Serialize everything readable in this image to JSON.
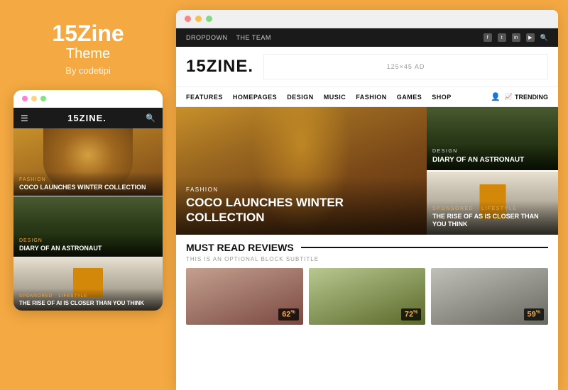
{
  "left": {
    "title": "15Zine",
    "subtitle": "Theme",
    "byline": "By codetipi",
    "dots": [
      "dot1",
      "dot2",
      "dot3"
    ],
    "phone": {
      "nav_logo": "15ZINE.",
      "cards": [
        {
          "category": "FASHION",
          "title": "COCO LAUNCHES WINTER COLLECTION"
        },
        {
          "category": "DESIGN",
          "title": "DIARY OF AN ASTRONAUT"
        },
        {
          "category": "SPONSORED · LIFESTYLE",
          "title": "THE RISE OF AI IS CLOSER THAN YOU THINK"
        }
      ]
    }
  },
  "browser": {
    "top_nav": {
      "left": [
        "DROPDOWN",
        "THE TEAM"
      ],
      "social": [
        "f",
        "t",
        "in",
        "yt"
      ],
      "search": "🔍"
    },
    "header": {
      "logo": "15ZINE.",
      "ad_text": "125×45 AD"
    },
    "nav": {
      "items": [
        "FEATURES",
        "HOMEPAGES",
        "DESIGN",
        "MUSIC",
        "FASHION",
        "GAMES",
        "SHOP"
      ],
      "trending": "TRENDING"
    },
    "hero": {
      "main": {
        "category": "FASHION",
        "title": "COCO LAUNCHES WINTER COLLECTION"
      },
      "cards": [
        {
          "category": "DESIGN",
          "title": "DIARY OF AN ASTRONAUT"
        },
        {
          "category": "SPONSORED · LIFESTYLE",
          "title": "THE RISE OF AS IS CLOSER THAN YOU THINK"
        }
      ]
    },
    "must_read": {
      "title": "MUST READ REVIEWS",
      "line": true,
      "subtitle": "THIS IS AN OPTIONAL BLOCK SUBTITLE",
      "cards": [
        {
          "score": "62",
          "unit": "%"
        },
        {
          "score": "72",
          "unit": "%"
        },
        {
          "score": "59",
          "unit": "%"
        }
      ]
    }
  }
}
